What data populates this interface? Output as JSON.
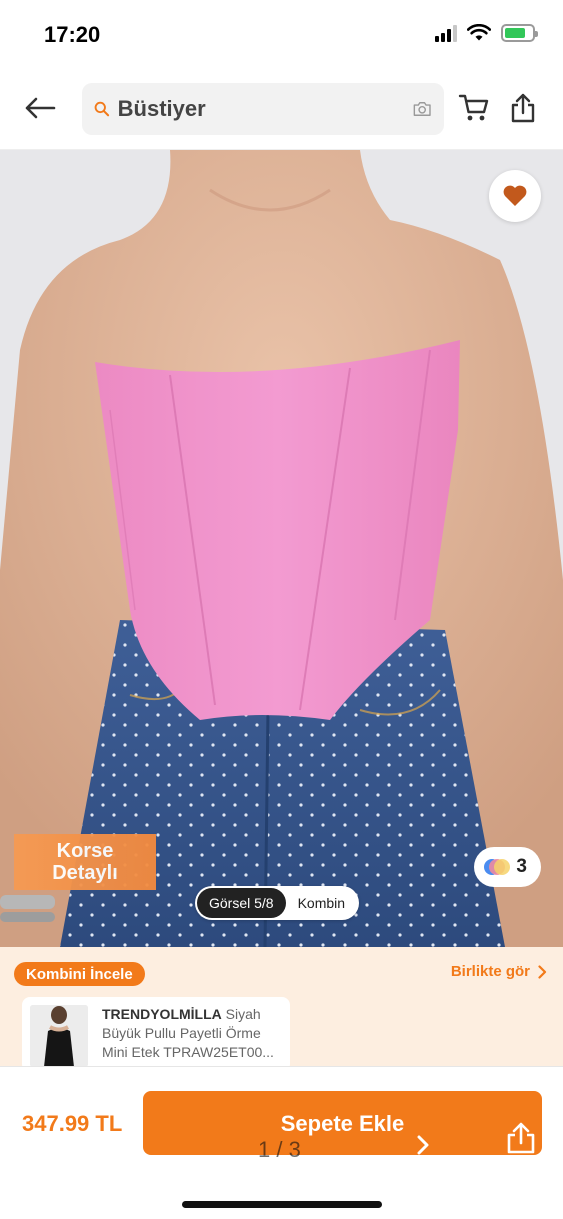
{
  "status_bar": {
    "time": "17:20",
    "battery_level": 0.75
  },
  "header": {
    "search_query": "Büstiyer",
    "icons": [
      "back-arrow-icon",
      "search-icon",
      "camera-icon",
      "cart-icon",
      "share-icon"
    ]
  },
  "product": {
    "promo_badge": "Korse\nDetaylı",
    "color_count": "3",
    "image_toggle": {
      "gallery_label": "Görsel 5/8",
      "kombin_label": "Kombin",
      "active": "gallery"
    },
    "favorited": true
  },
  "combine": {
    "title": "Kombini İncele",
    "see_together": "Birlikte gör",
    "item": {
      "brand": "TRENDYOLMİLLA",
      "description": "Siyah Büyük Pullu Payetli Örme Mini Etek TPRAW25ET00..."
    }
  },
  "bottom_bar": {
    "price": "347.99 TL",
    "add_to_cart": "Sepete Ekle",
    "pager": "1 / 3"
  },
  "colors": {
    "accent": "#f27a1a",
    "combine_bg": "#fdeee0",
    "heart": "#c2591c"
  }
}
